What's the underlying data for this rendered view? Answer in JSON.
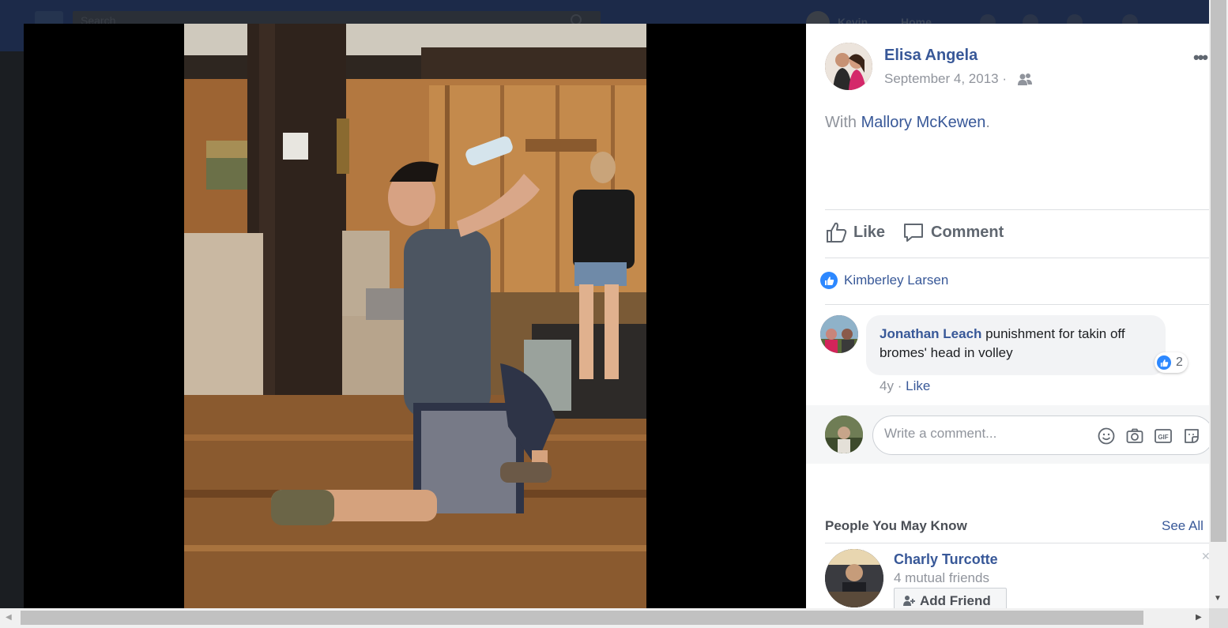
{
  "background": {
    "search_placeholder": "Search",
    "user_name": "Kevin",
    "home_label": "Home"
  },
  "post": {
    "author": "Elisa Angela",
    "date": "September 4, 2013 ·",
    "audience_icon": "friends-icon",
    "with_prefix": "With",
    "tagged_person": "Mallory McKewen",
    "with_suffix": ".",
    "more_label": "•••"
  },
  "actions": {
    "like_label": "Like",
    "comment_label": "Comment"
  },
  "reactions": {
    "liker_name": "Kimberley Larsen"
  },
  "comments": [
    {
      "author": "Jonathan Leach",
      "text": "punishment for takin off bromes' head in volley",
      "reaction_count": "2",
      "age": "4y",
      "separator": "·",
      "like_label": "Like"
    }
  ],
  "composer": {
    "placeholder": "Write a comment..."
  },
  "pymk": {
    "title": "People You May Know",
    "see_all": "See All",
    "person": {
      "name": "Charly Turcotte",
      "mutual": "4 mutual friends",
      "add_label": "Add Friend"
    }
  },
  "colors": {
    "link": "#385898",
    "like_blue": "#2d88ff",
    "muted": "#90949c"
  }
}
